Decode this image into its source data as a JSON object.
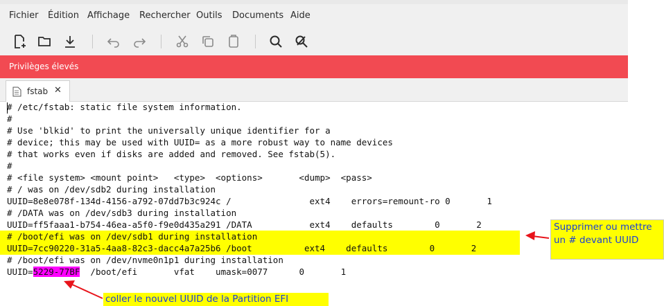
{
  "menubar": {
    "items": [
      "Fichier",
      "Édition",
      "Affichage",
      "Rechercher",
      "Outils",
      "Documents",
      "Aide"
    ]
  },
  "toolbar": {
    "icons": [
      "new-document-icon",
      "open-folder-icon",
      "save-download-icon",
      "undo-icon",
      "redo-icon",
      "cut-icon",
      "copy-icon",
      "paste-icon",
      "search-icon",
      "replace-icon"
    ]
  },
  "privilege_bar": {
    "label": "Privilèges élevés",
    "color": "#f24a52"
  },
  "tab": {
    "label": "fstab",
    "close": "✕"
  },
  "editor": {
    "lines": [
      "# /etc/fstab: static file system information.",
      "#",
      "# Use 'blkid' to print the universally unique identifier for a",
      "# device; this may be used with UUID= as a more robust way to name devices",
      "# that works even if disks are added and removed. See fstab(5).",
      "#",
      "# <file system> <mount point>   <type>  <options>       <dump>  <pass>",
      "# / was on /dev/sdb2 during installation",
      "UUID=8e8e078f-134d-4156-a792-07dd7b3c924c /               ext4    errors=remount-ro 0       1",
      "# /DATA was on /dev/sdb3 during installation",
      "UUID=ff5faaa1-b754-46ea-a5f0-f9e0d435a291 /DATA           ext4    defaults        0       2",
      "# /boot/efi was on /dev/sdb1 during installation",
      "UUID=7cc90220-31a5-4aa8-82c3-dacc4a7a25b6 /boot          ext4    defaults        0       2",
      "# /boot/efi was on /dev/nvme0n1p1 during installation"
    ],
    "last_line": {
      "prefix": "UUID=",
      "uuid": "5229-77BF",
      "rest": "  /boot/efi       vfat    umask=0077      0       1"
    }
  },
  "annotations": {
    "note_1": "Supprimer ou mettre un # devant UUID",
    "note_2": "coller le nouvel UUID de la Partition EFI",
    "highlight_color": "#ffff00",
    "uuid_highlight_color": "#ff00ff",
    "arrow_color": "#e8141b",
    "text_color": "#1a3fd6"
  }
}
